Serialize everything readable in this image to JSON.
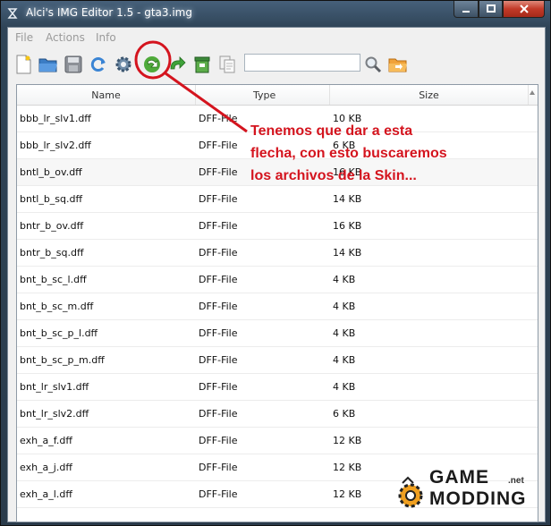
{
  "window": {
    "title": "Alci's IMG Editor 1.5 - gta3.img"
  },
  "menu": [
    "File",
    "Actions",
    "Info"
  ],
  "toolbar": {
    "search_value": "",
    "icons": [
      "new-file-icon",
      "open-folder-icon",
      "save-icon",
      "refresh-icon",
      "settings-gear-icon",
      "import-arrow-icon",
      "rebuild-arrow-icon",
      "delete-bin-icon",
      "copy-icon",
      "search-icon",
      "export-folder-icon"
    ]
  },
  "table": {
    "columns": [
      "Name",
      "Type",
      "Size"
    ],
    "rows": [
      {
        "name": "bbb_lr_slv1.dff",
        "type": "DFF-File",
        "size": "10 KB"
      },
      {
        "name": "bbb_lr_slv2.dff",
        "type": "DFF-File",
        "size": "6 KB"
      },
      {
        "name": "bntl_b_ov.dff",
        "type": "DFF-File",
        "size": "16 KB"
      },
      {
        "name": "bntl_b_sq.dff",
        "type": "DFF-File",
        "size": "14 KB"
      },
      {
        "name": "bntr_b_ov.dff",
        "type": "DFF-File",
        "size": "16 KB"
      },
      {
        "name": "bntr_b_sq.dff",
        "type": "DFF-File",
        "size": "14 KB"
      },
      {
        "name": "bnt_b_sc_l.dff",
        "type": "DFF-File",
        "size": "4 KB"
      },
      {
        "name": "bnt_b_sc_m.dff",
        "type": "DFF-File",
        "size": "4 KB"
      },
      {
        "name": "bnt_b_sc_p_l.dff",
        "type": "DFF-File",
        "size": "4 KB"
      },
      {
        "name": "bnt_b_sc_p_m.dff",
        "type": "DFF-File",
        "size": "4 KB"
      },
      {
        "name": "bnt_lr_slv1.dff",
        "type": "DFF-File",
        "size": "4 KB"
      },
      {
        "name": "bnt_lr_slv2.dff",
        "type": "DFF-File",
        "size": "6 KB"
      },
      {
        "name": "exh_a_f.dff",
        "type": "DFF-File",
        "size": "12 KB"
      },
      {
        "name": "exh_a_j.dff",
        "type": "DFF-File",
        "size": "12 KB"
      },
      {
        "name": "exh_a_l.dff",
        "type": "DFF-File",
        "size": "12 KB"
      }
    ]
  },
  "annotation": {
    "lines": [
      "Tenemos que dar a esta",
      "flecha, con esto buscaremos",
      "los archivos de la Skin..."
    ],
    "color": "#d4141e"
  },
  "watermark": {
    "line1": "GAME",
    "line2": "MODDING",
    "suffix": ".net"
  }
}
